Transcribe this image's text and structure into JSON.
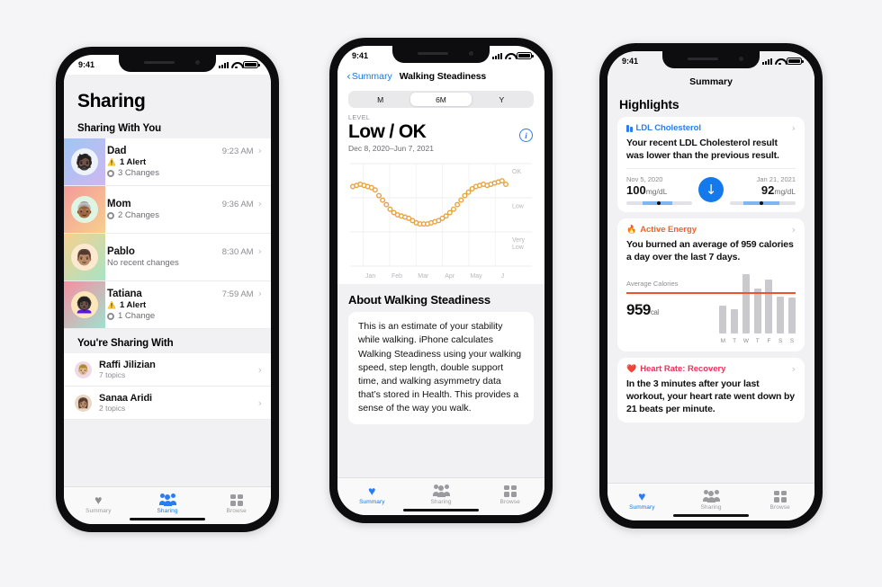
{
  "background": "#f5f5f7",
  "accent": "#1479ea",
  "status_bar": {
    "time": "9:41"
  },
  "phone1": {
    "title": "Sharing",
    "section1": "Sharing With You",
    "section2": "You're Sharing With",
    "sharing_with_you": [
      {
        "name": "Dad",
        "time": "9:23 AM",
        "alert": "1 Alert",
        "changes": "3 Changes",
        "emoji": "👨🏿‍🦳",
        "tile_from": "#9fc6f5",
        "tile_to": "#cdb8f0"
      },
      {
        "name": "Mom",
        "time": "9:36 AM",
        "alert": null,
        "changes": "2 Changes",
        "emoji": "👵🏾",
        "tile_from": "#f59a9a",
        "tile_to": "#f6cf8f"
      },
      {
        "name": "Pablo",
        "time": "8:30 AM",
        "alert": null,
        "changes": "No recent changes",
        "emoji": "👨🏽",
        "tile_from": "#f6d18f",
        "tile_to": "#a8e3c4"
      },
      {
        "name": "Tatiana",
        "time": "7:59 AM",
        "alert": "1 Alert",
        "changes": "1 Change",
        "emoji": "👩🏿‍🦱",
        "tile_from": "#f78fa0",
        "tile_to": "#9fe0cf"
      }
    ],
    "youre_sharing_with": [
      {
        "name": "Raffi Jilizian",
        "sub": "7 topics",
        "emoji": "👨🏼",
        "tint": "#f0d9e6"
      },
      {
        "name": "Sanaa Aridi",
        "sub": "2 topics",
        "emoji": "👩🏽",
        "tint": "#ead7c4"
      }
    ],
    "tabs": [
      {
        "label": "Summary",
        "icon": "heart-icon",
        "active": false
      },
      {
        "label": "Sharing",
        "icon": "people-icon",
        "active": true
      },
      {
        "label": "Browse",
        "icon": "grid-icon",
        "active": false
      }
    ]
  },
  "phone2": {
    "back_label": "Summary",
    "nav_title": "Walking Steadiness",
    "segments": [
      {
        "label": "M",
        "selected": false
      },
      {
        "label": "6M",
        "selected": true
      },
      {
        "label": "Y",
        "selected": false
      }
    ],
    "level_label": "LEVEL",
    "level_value": "Low / OK",
    "date_range": "Dec 8, 2020–Jun 7, 2021",
    "info_glyph": "i",
    "about_heading": "About Walking Steadiness",
    "about_text": "This is an estimate of your stability while walking. iPhone calculates Walking Steadiness using your walking speed, step length, double support time, and walking asymmetry data that’s stored in Health. This provides a sense of the way you walk.",
    "tabs": [
      {
        "label": "Summary",
        "icon": "heart-icon",
        "active": true
      },
      {
        "label": "Sharing",
        "icon": "people-icon",
        "active": false
      },
      {
        "label": "Browse",
        "icon": "grid-icon",
        "active": false
      }
    ]
  },
  "phone3": {
    "nav_title": "Summary",
    "page_title": "Highlights",
    "ldl": {
      "title": "LDL Cholesterol",
      "body": "Your recent LDL Cholesterol result was lower than the previous result.",
      "left_date": "Nov 5, 2020",
      "left_value": "100",
      "left_unit": "mg/dL",
      "right_date": "Jan 21, 2021",
      "right_value": "92",
      "right_unit": "mg/dL",
      "arrow": "↓",
      "arrow_color": "#1479ea"
    },
    "active_energy": {
      "title": "Active Energy",
      "body": "You burned an average of 959 calories a day over the last 7 days.",
      "chart_label": "Average Calories",
      "average_value": "959",
      "average_unit": "cal"
    },
    "heart_rate": {
      "title": "Heart Rate: Recovery",
      "body": "In the 3 minutes after your last workout, your heart rate went down by 21 beats per minute."
    },
    "tabs": [
      {
        "label": "Summary",
        "icon": "heart-icon",
        "active": true
      },
      {
        "label": "Sharing",
        "icon": "people-icon",
        "active": false
      },
      {
        "label": "Browse",
        "icon": "grid-icon",
        "active": false
      }
    ]
  },
  "chart_data": [
    {
      "type": "scatter",
      "title": "Walking Steadiness",
      "subtitle": "Dec 8, 2020–Jun 7, 2021",
      "xlabel": "",
      "ylabel": "",
      "x_tick_labels": [
        "Jan",
        "Feb",
        "Mar",
        "Apr",
        "May",
        "J"
      ],
      "y_tick_labels": [
        "OK",
        "Low",
        "Very Low"
      ],
      "ylim": [
        0,
        100
      ],
      "grid": true,
      "marker_color": "#e8a33d",
      "marker_fill": "#ffffff",
      "values": [
        78,
        79,
        80,
        79,
        78,
        77,
        75,
        70,
        66,
        62,
        58,
        55,
        53,
        52,
        51,
        50,
        48,
        46,
        45,
        45,
        45,
        46,
        47,
        48,
        50,
        52,
        55,
        58,
        62,
        66,
        70,
        73,
        76,
        78,
        79,
        80,
        79,
        80,
        81,
        82,
        83,
        80
      ]
    },
    {
      "type": "bar",
      "title": "Average Calories",
      "categories": [
        "M",
        "T",
        "W",
        "T",
        "F",
        "S",
        "S"
      ],
      "values": [
        620,
        560,
        1340,
        1010,
        1210,
        830,
        820
      ],
      "average": 959,
      "average_line_color": "#f0522b",
      "bar_color": "#c9c9ce",
      "ylabel": "cal",
      "grid": false
    }
  ]
}
